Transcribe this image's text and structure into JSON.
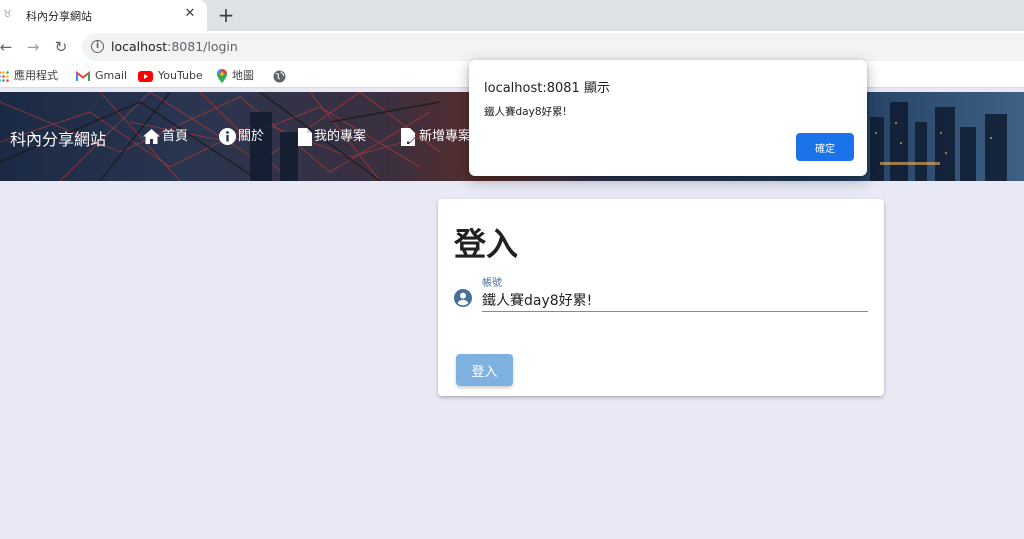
{
  "browser": {
    "tab_title": "科內分享網站",
    "new_tab_symbol": "+",
    "close_symbol": "✕",
    "url_host": "localhost",
    "url_path": ":8081/login",
    "bookmarks": [
      {
        "label": "應用程式",
        "icon": "apps-grid-icon"
      },
      {
        "label": "Gmail",
        "icon": "gmail-icon"
      },
      {
        "label": "YouTube",
        "icon": "youtube-icon"
      },
      {
        "label": "地圖",
        "icon": "maps-pin-icon"
      },
      {
        "label": "",
        "icon": "globe-icon"
      }
    ]
  },
  "site": {
    "brand": "科內分享網站",
    "nav": [
      {
        "label": "首頁",
        "icon": "home-icon"
      },
      {
        "label": "關於",
        "icon": "info-icon"
      },
      {
        "label": "我的專案",
        "icon": "document-icon"
      },
      {
        "label": "新增專案",
        "icon": "edit-document-icon"
      }
    ]
  },
  "login": {
    "title": "登入",
    "account_label": "帳號",
    "account_value": "鐵人賽day8好累!",
    "submit_label": "登入"
  },
  "alert": {
    "title": "localhost:8081 顯示",
    "message": "鐵人賽day8好累!",
    "ok_label": "確定"
  },
  "colors": {
    "page_bg": "#e8e9f5",
    "primary": "#1a73e8",
    "login_button": "#7fb1e0",
    "label_blue": "#476f9a"
  }
}
